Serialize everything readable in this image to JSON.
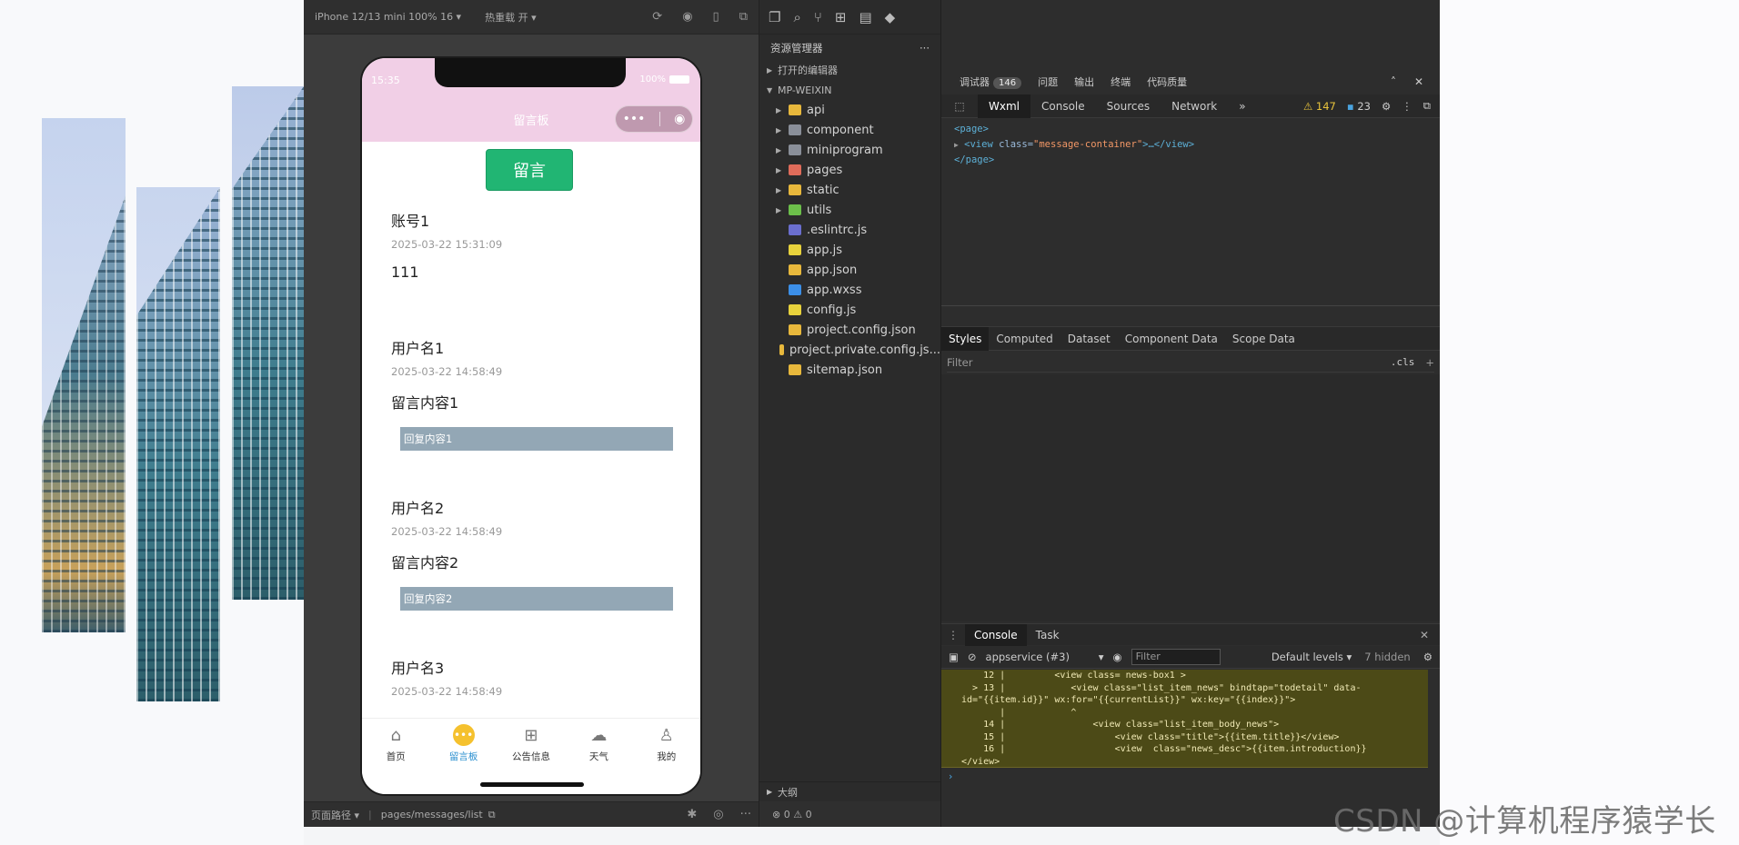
{
  "simulator": {
    "device_label": "iPhone 12/13 mini 100% 16 ▾",
    "hot_reload_label": "热重载 开 ▾",
    "footer_path_label": "页面路径 ▾",
    "footer_path": "pages/messages/list"
  },
  "phone": {
    "status_time": "15:35",
    "battery": "100%",
    "nav_title": "留言板",
    "capsule_more": "•••",
    "capsule_close": "◉",
    "message_button": "留言",
    "messages": [
      {
        "name": "账号1",
        "time": "2025-03-22 15:31:09",
        "content": "111",
        "reply": ""
      },
      {
        "name": "用户名1",
        "time": "2025-03-22 14:58:49",
        "content": "留言内容1",
        "reply": "回复内容1"
      },
      {
        "name": "用户名2",
        "time": "2025-03-22 14:58:49",
        "content": "留言内容2",
        "reply": "回复内容2"
      },
      {
        "name": "用户名3",
        "time": "2025-03-22 14:58:49",
        "content": "",
        "reply": ""
      }
    ],
    "tabs": [
      {
        "label": "首页",
        "icon": "home-icon"
      },
      {
        "label": "留言板",
        "icon": "message-icon"
      },
      {
        "label": "公告信息",
        "icon": "grid-icon"
      },
      {
        "label": "天气",
        "icon": "cloud-icon"
      },
      {
        "label": "我的",
        "icon": "user-icon"
      }
    ]
  },
  "explorer": {
    "title": "资源管理器",
    "more": "···",
    "open_editors": "打开的编辑器",
    "project": "MP-WEIXIN",
    "items": [
      {
        "name": "api",
        "kind": "folder",
        "color": "#e8b83c"
      },
      {
        "name": "component",
        "kind": "folder",
        "color": "#8a8f99"
      },
      {
        "name": "miniprogram",
        "kind": "folder",
        "color": "#8a8f99"
      },
      {
        "name": "pages",
        "kind": "folder",
        "color": "#e06c5a"
      },
      {
        "name": "static",
        "kind": "folder",
        "color": "#e8b83c"
      },
      {
        "name": "utils",
        "kind": "folder",
        "color": "#6cbf4a"
      },
      {
        "name": ".eslintrc.js",
        "kind": "file",
        "color": "#6b6fcf"
      },
      {
        "name": "app.js",
        "kind": "file",
        "color": "#e8d23c"
      },
      {
        "name": "app.json",
        "kind": "file",
        "color": "#e8b83c"
      },
      {
        "name": "app.wxss",
        "kind": "file",
        "color": "#3c8fe8"
      },
      {
        "name": "config.js",
        "kind": "file",
        "color": "#e8d23c"
      },
      {
        "name": "project.config.json",
        "kind": "file",
        "color": "#e8b83c"
      },
      {
        "name": "project.private.config.js...",
        "kind": "file",
        "color": "#e8b83c"
      },
      {
        "name": "sitemap.json",
        "kind": "file",
        "color": "#e8b83c"
      }
    ],
    "outline": "大纲",
    "status_errors": "⊗ 0 ⚠ 0"
  },
  "devtools": {
    "main_tabs": [
      "调试器",
      "问题",
      "输出",
      "终端",
      "代码质量"
    ],
    "debugger_badge": "146",
    "sub_tabs": [
      "Wxml",
      "Console",
      "Sources",
      "Network"
    ],
    "more_tabs": "»",
    "warnings": "⚠ 147",
    "messages_count": "23",
    "dom": {
      "line1": "<page>",
      "line2_tag_open": "<view ",
      "line2_attr": "class=",
      "line2_val": "\"message-container\"",
      "line2_close": ">…</view>",
      "line3": "</page>"
    },
    "style_tabs": [
      "Styles",
      "Computed",
      "Dataset",
      "Component Data",
      "Scope Data"
    ],
    "styles_filter": "Filter",
    "cls": ".cls",
    "plus": "+",
    "console_tabs": [
      "Console",
      "Task"
    ],
    "console_context": "appservice (#3)",
    "console_filter": "Filter",
    "console_levels": "Default levels ▾",
    "console_hidden": "7 hidden",
    "console_error_lines": [
      "    12 |         <view class= news-box1 >",
      "  > 13 |            <view class=\"list_item_news\" bindtap=\"todetail\" data-",
      "id=\"{{item.id}}\" wx:for=\"{{currentList}}\" wx:key=\"{{index}}\">",
      "       |            ^",
      "    14 |                <view class=\"list_item_body_news\">",
      "    15 |                    <view class=\"title\">{{item.title}}</view>",
      "    16 |                    <view  class=\"news_desc\">{{item.introduction}}",
      "</view>"
    ],
    "prompt": "›"
  },
  "watermark": "CSDN @计算机程序猿学长"
}
